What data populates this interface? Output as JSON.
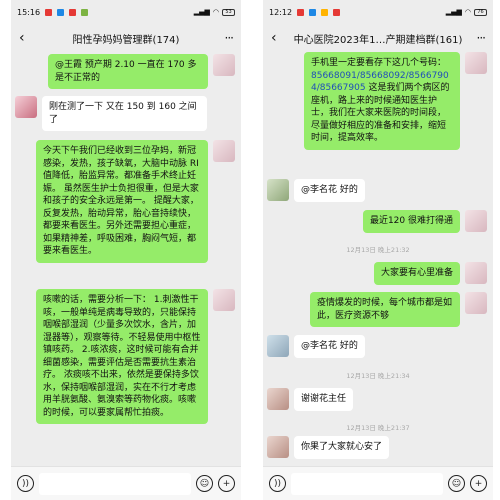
{
  "left": {
    "status": {
      "time": "15:16",
      "battery": "53"
    },
    "title": "阳性孕妈妈管理群(174)",
    "messages": [
      {
        "text": "@王霞 预产期 2.10 一直在 170 多是不正常的"
      },
      {
        "text": "刚在测了一下 又在 150 到 160 之间了"
      },
      {
        "text": "今天下午我们已经收到三位孕妈，新冠感染，发热，孩子缺氧，大脑中动脉 RI 值降低，胎监异常。都准备手术终止妊娠。 虽然医生护士负担很重，但是大家和孩子的安全永远是第一。 提醒大家，反复发热，胎动异常，胎心音持续快，都要来看医生。另外还需要担心重症，如果精神差，呼吸困难，胸闷气短，都要来看医生。"
      },
      {
        "text": "咳嗽的话，需要分析一下： 1.刺激性干咳，一般单纯是病毒导致的，只能保持咽喉部湿润（少量多次饮水，含片，加湿器等），观察等待。不轻易使用中枢性镇咳药。 2.咳浓痰，这时候可能有合并细菌感染，需要评估是否需要抗生素治疗。 浓痰咳不出来，依然是要保持多饮水，保持咽喉部湿润，实在不行才考虑用羊胱氨酸、氨溴索等药物化痰。咳嗽的时候，可以要家属帮忙拍痰。"
      }
    ],
    "input_icons": {
      "voice": "))",
      "emoji": "☺",
      "plus": "+"
    }
  },
  "right": {
    "status": {
      "time": "12:12",
      "battery": "76"
    },
    "title": "中心医院2023年1…产期建档群(161)",
    "messages": [
      {
        "text_before": "手机里一定要看存下这几个号码：",
        "phones": "85668091/85668092/85667904/85667905",
        "text_after": "这是我们两个病区的座机，路上来的时候通知医生护士，我们在大家来医院的时间段，尽量做好相应的准备和安排，缩短时间，提高效率。"
      },
      {
        "text": "@李名花  好的"
      },
      {
        "text": "最近120 很难打得通"
      },
      {
        "text": "大家要有心里准备"
      },
      {
        "text": "疫情爆发的时候，每个城市都是如此，医疗资源不够"
      },
      {
        "text": "@李名花  好的"
      },
      {
        "text": "谢谢花主任"
      },
      {
        "text": "你果了大家就心安了"
      }
    ],
    "timestamps": [
      "12月13日 晚上21:32",
      "12月13日 晚上21:34",
      "12月13日 晚上21:37"
    ],
    "input_icons": {
      "voice": "))",
      "emoji": "☺",
      "plus": "+"
    }
  }
}
